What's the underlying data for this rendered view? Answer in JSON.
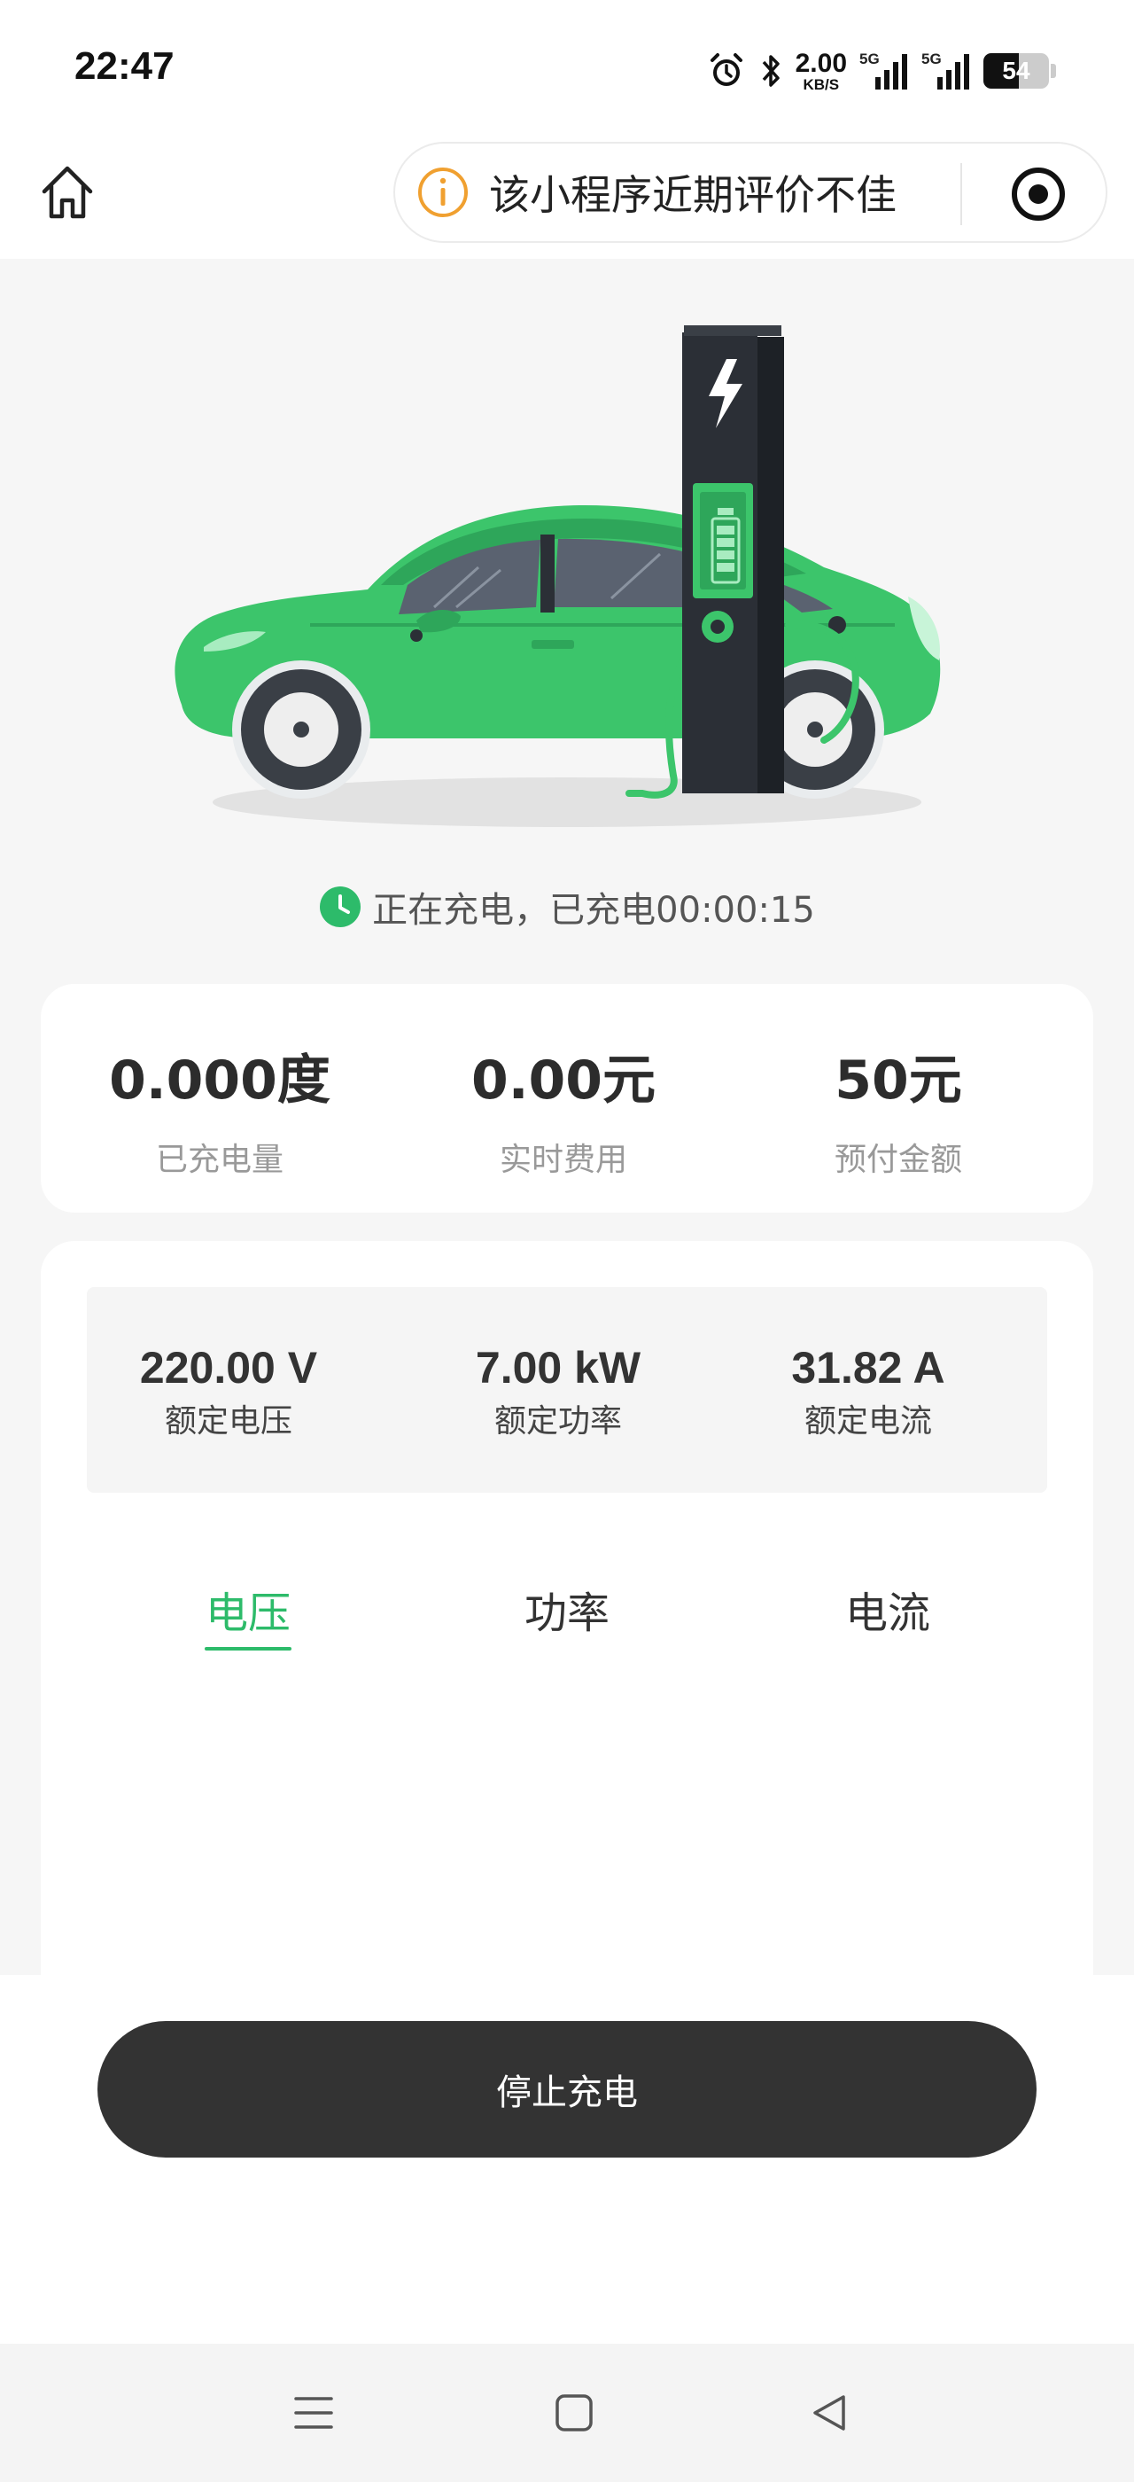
{
  "status_bar": {
    "time": "22:47",
    "net_speed_value": "2.00",
    "net_speed_unit": "KB/S",
    "sim1_label": "5G",
    "sim2_label": "5G",
    "battery_level": "54"
  },
  "nav": {
    "notice_text": "该小程序近期评价不佳"
  },
  "charging": {
    "status_text": "正在充电，已充电00:00:15"
  },
  "summary": {
    "items": [
      {
        "value": "0.000度",
        "label": "已充电量"
      },
      {
        "value": "0.00元",
        "label": "实时费用"
      },
      {
        "value": "50元",
        "label": "预付金额"
      }
    ]
  },
  "rated": {
    "items": [
      {
        "value": "220.00 V",
        "label": "额定电压"
      },
      {
        "value": "7.00 kW",
        "label": "额定功率"
      },
      {
        "value": "31.82 A",
        "label": "额定电流"
      }
    ]
  },
  "tabs": {
    "items": [
      {
        "label": "电压"
      },
      {
        "label": "功率"
      },
      {
        "label": "电流"
      }
    ],
    "active_index": 0
  },
  "actions": {
    "stop_label": "停止充电"
  },
  "colors": {
    "accent": "#2dbb6a",
    "car_body": "#3cc56b",
    "button_dark": "#333333",
    "notice_orange": "#f0a030"
  }
}
